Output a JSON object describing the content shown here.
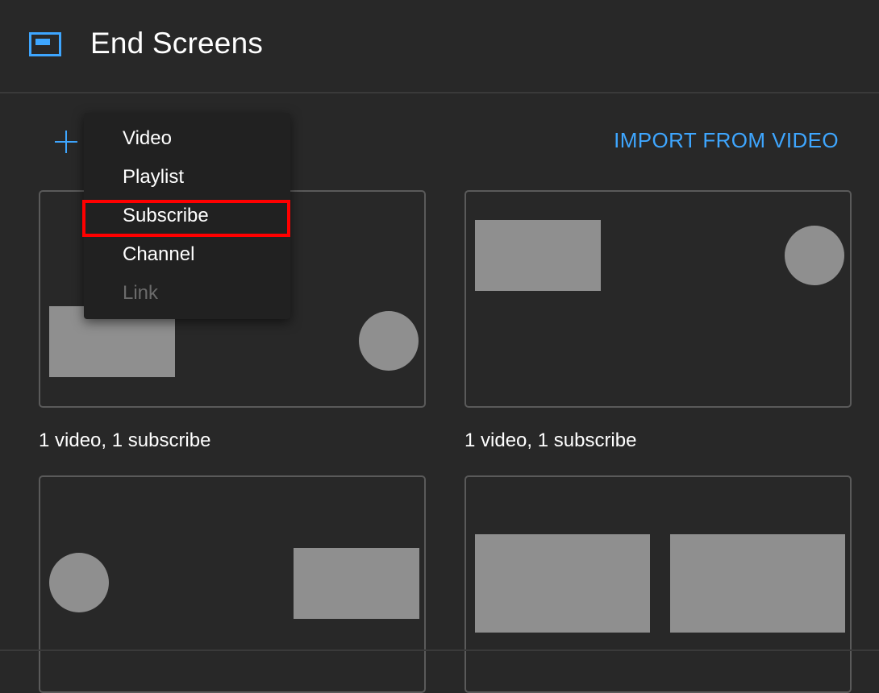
{
  "header": {
    "title": "End Screens",
    "icon": "end-screen-icon"
  },
  "toolbar": {
    "add_icon": "plus-icon",
    "import_label": "IMPORT FROM VIDEO"
  },
  "dropdown": {
    "items": [
      {
        "label": "Video",
        "enabled": true,
        "highlighted": false
      },
      {
        "label": "Playlist",
        "enabled": true,
        "highlighted": false
      },
      {
        "label": "Subscribe",
        "enabled": true,
        "highlighted": true
      },
      {
        "label": "Channel",
        "enabled": true,
        "highlighted": false
      },
      {
        "label": "Link",
        "enabled": false,
        "highlighted": false
      }
    ]
  },
  "templates": [
    {
      "caption": "1 video, 1 subscribe"
    },
    {
      "caption": "1 video, 1 subscribe"
    },
    {
      "caption": ""
    },
    {
      "caption": ""
    }
  ],
  "colors": {
    "accent": "#3ea6ff",
    "highlight": "#ff0000",
    "background": "#282828",
    "menu_background": "#212121",
    "placeholder": "#8f8f8f",
    "disabled_text": "#6b6b6b"
  }
}
